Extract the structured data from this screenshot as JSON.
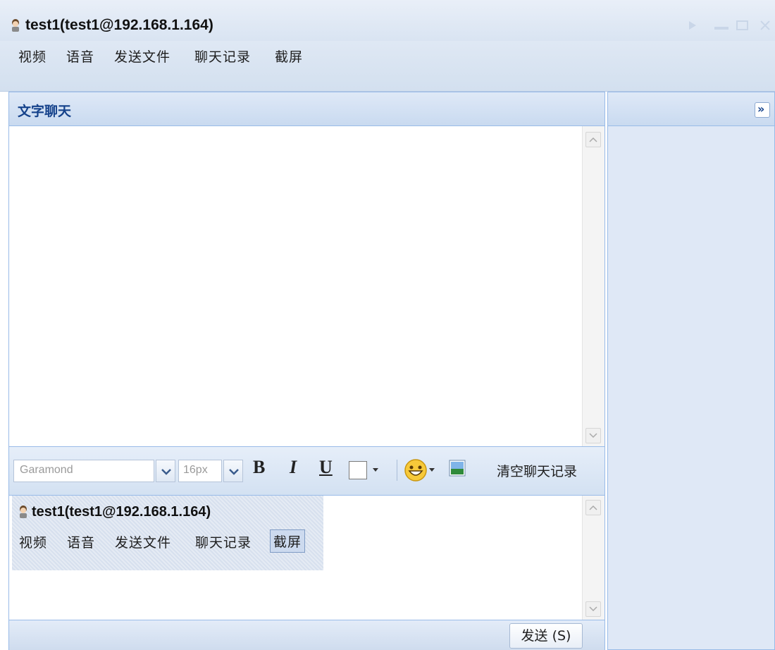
{
  "window": {
    "title": "test1(test1@192.168.1.164)"
  },
  "menu": {
    "video": "视频",
    "voice": "语音",
    "send_file": "发送文件",
    "chat_history": "聊天记录",
    "screenshot": "截屏"
  },
  "chat_panel": {
    "title": "文字聊天"
  },
  "toolbar": {
    "font": "Garamond",
    "size": "16px",
    "bold": "B",
    "italic": "I",
    "underline": "U",
    "clear_history": "清空聊天记录"
  },
  "pasted_screenshot": {
    "title": "test1(test1@192.168.1.164)",
    "menu": [
      "视频",
      "语音",
      "发送文件",
      "聊天记录",
      "截屏"
    ]
  },
  "send_button": "发送 (S)",
  "side_panel": {
    "expand_label": "»"
  },
  "colors": {
    "accent": "#15428b",
    "panel_border": "#99bbe8",
    "header_bg": "#c9daf0"
  }
}
